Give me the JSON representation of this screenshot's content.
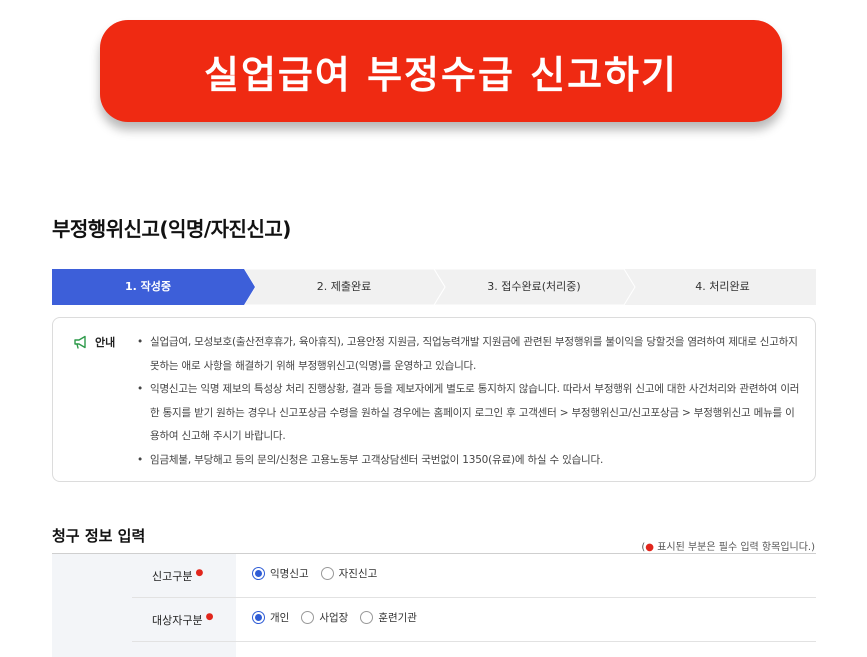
{
  "banner": {
    "title": "실업급여 부정수급 신고하기"
  },
  "page": {
    "title": "부정행위신고(익명/자진신고)"
  },
  "steps": [
    {
      "label": "1. 작성중",
      "active": true
    },
    {
      "label": "2. 제출완료",
      "active": false
    },
    {
      "label": "3. 접수완료(처리중)",
      "active": false
    },
    {
      "label": "4. 처리완료",
      "active": false
    }
  ],
  "notice": {
    "label": "안내",
    "items": [
      "실업급여, 모성보호(출산전후휴가, 육아휴직), 고용안정 지원금, 직업능력개발 지원금에 관련된 부정행위를 불이익을 당할것을 염려하여 제대로 신고하지 못하는 애로 사항을 해결하기 위해 부정행위신고(익명)를 운영하고 있습니다.",
      "익명신고는 익명 제보의 특성상 처리 진행상황, 결과 등을 제보자에게 별도로 통지하지 않습니다. 따라서 부정행위 신고에 대한 사건처리와 관련하여 이러한 통지를 받기 원하는 경우나 신고포상금 수령을 원하실 경우에는 홈페이지 로그인 후 고객센터 > 부정행위신고/신고포상금 > 부정행위신고 메뉴를 이용하여 신고해 주시기 바랍니다.",
      "임금체불, 부당해고 등의 문의/신청은 고용노동부 고객상담센터 국번없이 1350(유료)에 하실 수 있습니다."
    ]
  },
  "section": {
    "title": "청구 정보 입력",
    "required_note": "표시된 부분은 필수 입력 항목입니다.)",
    "required_open": "(",
    "required_mark": "●"
  },
  "form": {
    "report_type": {
      "label": "신고구분",
      "options": [
        "익명신고",
        "자진신고"
      ],
      "selected": "익명신고"
    },
    "target_type": {
      "label": "대상자구분",
      "options": [
        "개인",
        "사업장",
        "훈련기관"
      ],
      "selected": "개인"
    }
  },
  "colors": {
    "banner": "#ef2a12",
    "active_step": "#3d5fd9",
    "inactive_step": "#f1f1f1",
    "required": "#e1261c"
  }
}
